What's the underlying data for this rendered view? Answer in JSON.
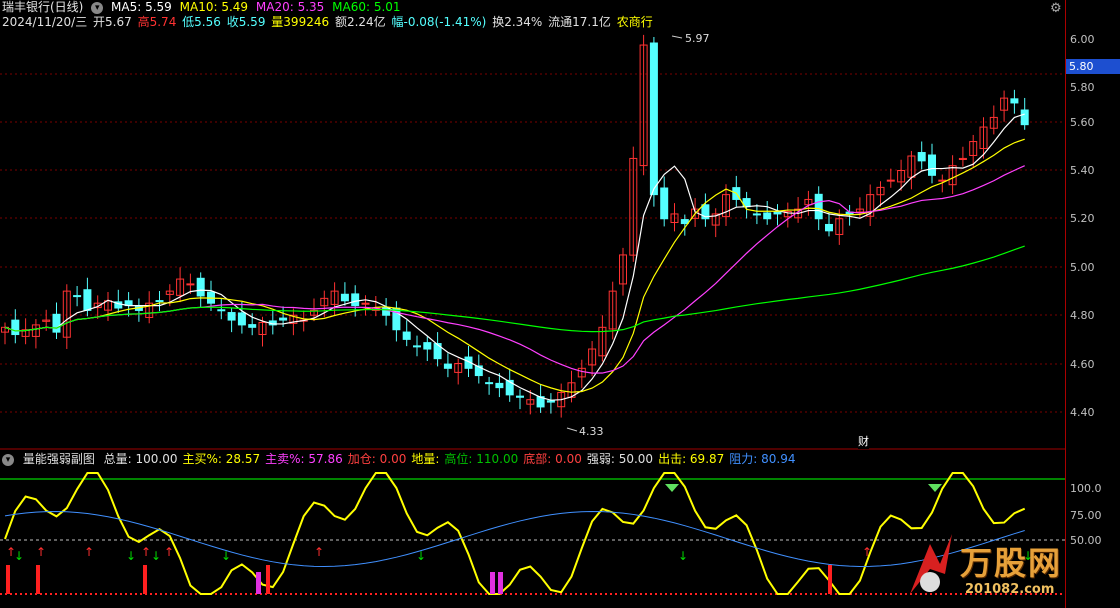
{
  "header": {
    "stock_name": "瑞丰银行(日线)",
    "ma5": "MA5: 5.59",
    "ma10": "MA10: 5.49",
    "ma20": "MA20: 5.35",
    "ma60": "MA60: 5.01",
    "date": "2024/11/20/三",
    "open": "开5.67",
    "high": "高5.74",
    "low": "低5.56",
    "close": "收5.59",
    "volume": "量399246",
    "amount": "额2.24亿",
    "change": "幅-0.08(-1.41%)",
    "turnover": "换2.34%",
    "float_value": "流通17.1亿",
    "sector": "农商行"
  },
  "price_axis": {
    "labels": [
      "6.00",
      "5.80",
      "5.60",
      "5.40",
      "5.20",
      "5.00",
      "4.80",
      "4.60",
      "4.40"
    ],
    "current_price": "5.80"
  },
  "annotations": {
    "high_label": "5.97",
    "low_label": "4.33",
    "fin_marker": "财"
  },
  "indicator": {
    "name": "量能强弱副图",
    "items": [
      {
        "text": "总量: 100.00",
        "color": "#e0e0e0"
      },
      {
        "text": "主买%: 28.57",
        "color": "#ffff00"
      },
      {
        "text": "主卖%: 57.86",
        "color": "#ff40ff"
      },
      {
        "text": "加仓: 0.00",
        "color": "#ff4040"
      },
      {
        "text": "地量:",
        "color": "#ffff00"
      },
      {
        "text": "高位: 110.00",
        "color": "#00c000"
      },
      {
        "text": "底部: 0.00",
        "color": "#ff4040"
      },
      {
        "text": "强弱: 50.00",
        "color": "#e0e0e0"
      },
      {
        "text": "出击: 69.87",
        "color": "#ffff00"
      },
      {
        "text": "阻力: 80.94",
        "color": "#4090ff"
      }
    ],
    "axis_labels": [
      "100.0",
      "75.00",
      "50.00"
    ]
  },
  "logo": {
    "text": "万股网",
    "url": "201082.com"
  },
  "colors": {
    "up": "#ff3232",
    "down": "#54ffff",
    "ma5": "#ffffff",
    "ma10": "#ffff00",
    "ma20": "#ff40ff",
    "ma60": "#00ff00",
    "grid": "#800000"
  }
}
